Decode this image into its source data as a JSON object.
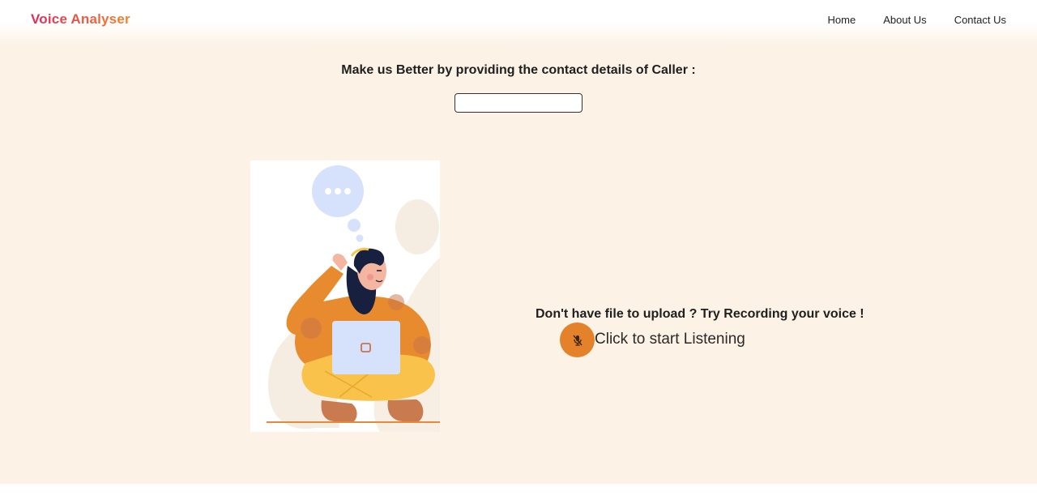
{
  "navbar": {
    "brand": "Voice Analyser",
    "links": [
      {
        "label": "Home"
      },
      {
        "label": "About Us"
      },
      {
        "label": "Contact Us"
      }
    ]
  },
  "contact": {
    "title": "Make us Better by providing the contact details of Caller :",
    "input_value": "",
    "input_placeholder": ""
  },
  "recording": {
    "title": "Don't have file to upload ? Try Recording your voice !",
    "button_icon": "mic-off-icon",
    "button_label": "Click to start Listening"
  },
  "colors": {
    "brand_gradient_start": "#e8245a",
    "brand_gradient_end": "#f2852a",
    "page_background": "#fcf2e6",
    "mic_button": "#e3822a"
  }
}
